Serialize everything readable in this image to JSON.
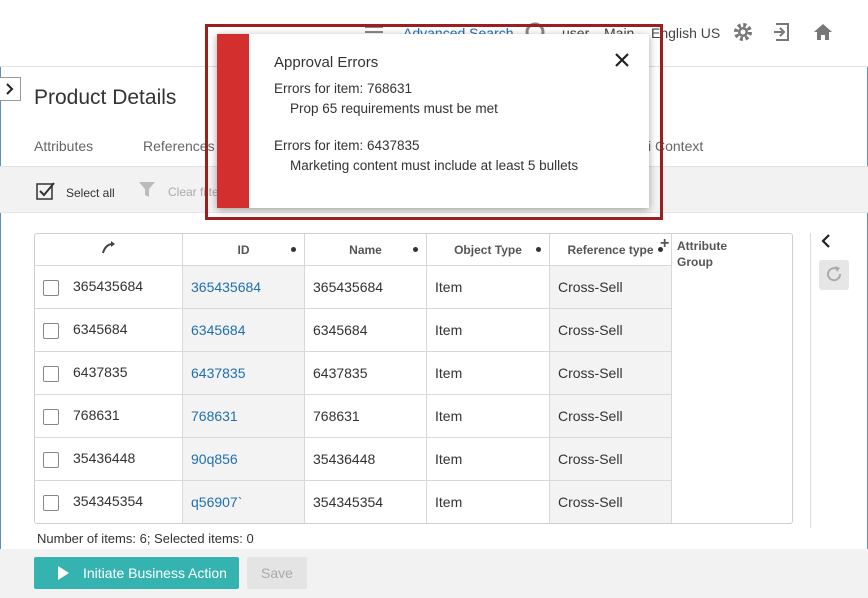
{
  "header": {
    "advanced_search": "Advanced Search",
    "user": "user",
    "main": "Main",
    "language": "English US",
    "icons": [
      "list-icon",
      "clock-icon",
      "gear-icon",
      "logout-icon",
      "home-icon"
    ]
  },
  "page": {
    "title": "Product Details"
  },
  "tabs": [
    {
      "label": "Attributes"
    },
    {
      "label": "References"
    },
    {
      "label": "i Context"
    }
  ],
  "toolbar": {
    "select_all": "Select all",
    "clear_filter": "Clear filte"
  },
  "table": {
    "columns": [
      "ID",
      "Name",
      "Object Type",
      "Reference type"
    ],
    "attribute_group": "Attribute Group",
    "rows": [
      {
        "key": "365435684",
        "id": "365435684",
        "name": "365435684",
        "type": "Item",
        "ref": "Cross-Sell"
      },
      {
        "key": "6345684",
        "id": "6345684",
        "name": "6345684",
        "type": "Item",
        "ref": "Cross-Sell"
      },
      {
        "key": "6437835",
        "id": "6437835",
        "name": "6437835",
        "type": "Item",
        "ref": "Cross-Sell"
      },
      {
        "key": "768631",
        "id": "768631",
        "name": "768631",
        "type": "Item",
        "ref": "Cross-Sell"
      },
      {
        "key": "35436448",
        "id": "90q856",
        "name": "35436448",
        "type": "Item",
        "ref": "Cross-Sell"
      },
      {
        "key": "354345354",
        "id": "q56907`",
        "name": "354345354",
        "type": "Item",
        "ref": "Cross-Sell"
      }
    ]
  },
  "status": {
    "count": "Number of items: 6; Selected items: 0"
  },
  "footer": {
    "initiate": "Initiate Business Action",
    "save": "Save"
  },
  "modal": {
    "title": "Approval Errors",
    "errors": [
      {
        "head": "Errors for item: 768631",
        "message": "Prop 65 requirements must be met"
      },
      {
        "head": "Errors for item: 6437835",
        "message": "Marketing content must include at least 5 bullets"
      }
    ],
    "accent": "#d32f2f"
  },
  "colors": {
    "link": "#1f6fb2",
    "primary": "#34b3b0",
    "outline": "#9c1f1f"
  }
}
